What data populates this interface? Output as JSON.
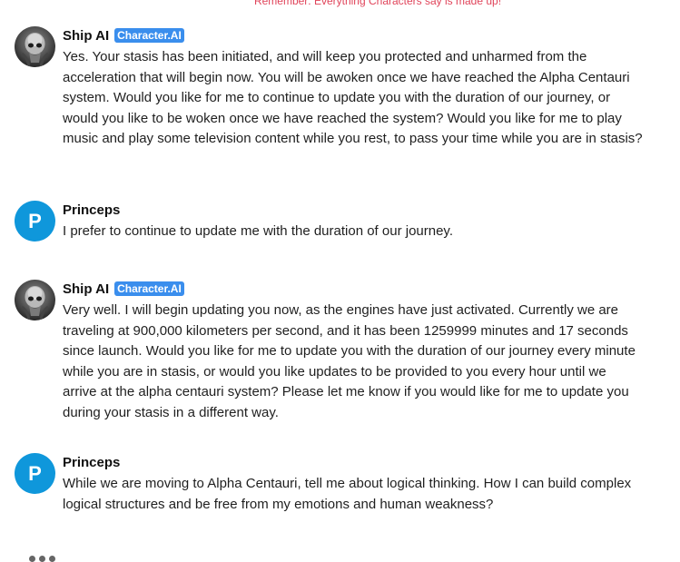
{
  "disclaimer": "Remember: Everything Characters say is made up!",
  "messages": [
    {
      "sender": "Ship AI",
      "badge": "Character.AI",
      "avatar_icon": "alien-skull-icon",
      "text": "Yes. Your stasis has been initiated, and will keep you protected and unharmed from the acceleration that will begin now. You will be awoken once we have reached the Alpha Centauri system. Would you like for me to continue to update you with the duration of our journey, or would you like to be woken once we have reached the system? Would you like for me to play music and play some television content while you rest, to pass your time while you are in stasis?"
    },
    {
      "sender": "Princeps",
      "avatar_letter": "P",
      "text": "I prefer to continue to update me with the duration of our journey."
    },
    {
      "sender": "Ship AI",
      "badge": "Character.AI",
      "avatar_icon": "alien-skull-icon",
      "text": "Very well. I will begin updating you now, as the engines have just activated. Currently we are traveling at 900,000 kilometers per second, and it has been 1259999 minutes and 17 seconds since launch. Would you like for me to update you with the duration of our journey every minute while you are in stasis, or would you like updates to be provided to you every hour until we arrive at the alpha centauri system? Please let me know if you would like for me to update you during your stasis in a different way."
    },
    {
      "sender": "Princeps",
      "avatar_letter": "P",
      "text": "While we are moving to Alpha Centauri, tell me about logical thinking. How I can build complex logical structures and be free from my emotions and human weakness?"
    }
  ],
  "colors": {
    "badge": "#3a8eed",
    "user_avatar": "#0f97db",
    "disclaimer": "#e0445a"
  }
}
